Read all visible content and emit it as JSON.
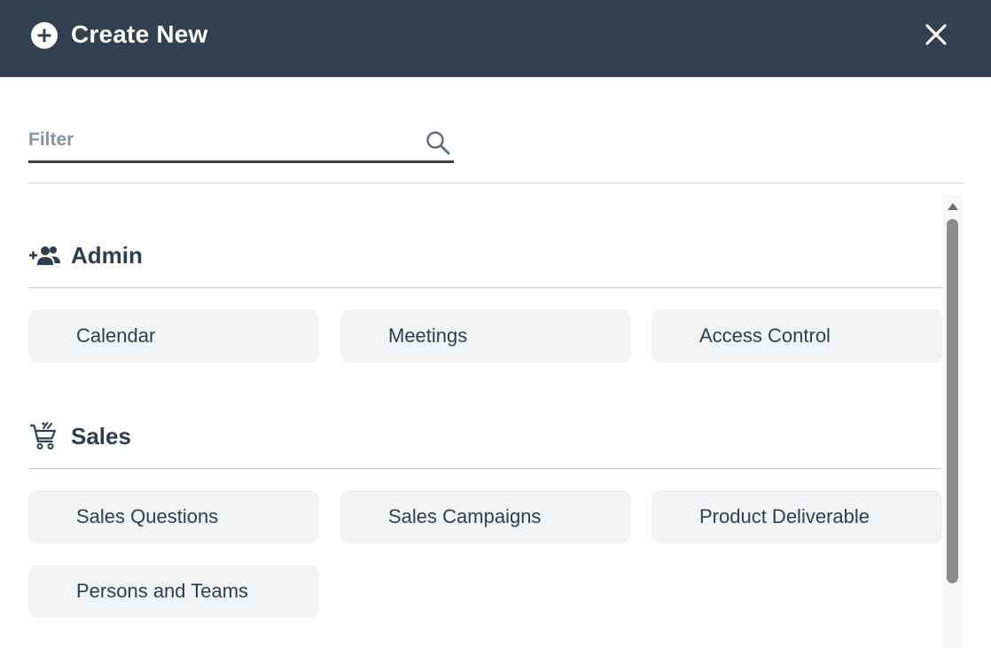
{
  "header": {
    "title": "Create New",
    "plus_icon": "plus-circle-icon",
    "close_icon": "close-icon"
  },
  "filter": {
    "placeholder": "Filter",
    "value": "",
    "icon": "search-icon"
  },
  "sections": [
    {
      "label": "Admin",
      "icon": "add-users-icon",
      "items": [
        "Calendar",
        "Meetings",
        "Access Control"
      ]
    },
    {
      "label": "Sales",
      "icon": "cart-icon",
      "items": [
        "Sales Questions",
        "Sales Campaigns",
        "Product Deliverable",
        "Persons and Teams"
      ]
    }
  ],
  "colors": {
    "header_bg": "#324050",
    "tile_bg": "#f2f3f5",
    "text": "#2c3e50"
  }
}
